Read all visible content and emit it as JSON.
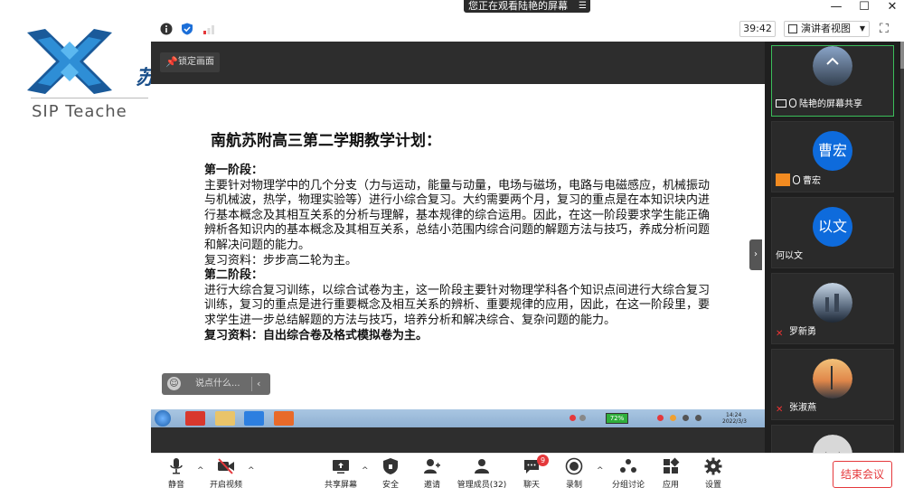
{
  "banner": {
    "text": "您正在观看陆艳的屏幕"
  },
  "topbar": {
    "timer": "39:42",
    "view_label": "演讲者视图"
  },
  "share": {
    "pin_label": "锁定画面",
    "chat_placeholder": "说点什么..."
  },
  "document": {
    "title": "南航苏附高三第二学期教学计划：",
    "paragraphs": [
      {
        "text": "第一阶段：",
        "bold": true
      },
      {
        "text": "主要针对物理学中的几个分支（力与运动，能量与动量，电场与磁场，电路与电磁感应，机械振动与机械波，热学，物理实验等）进行小综合复习。大约需要两个月，复习的重点是在本知识块内进行基本概念及其相互关系的分析与理解，基本规律的综合运用。因此，在这一阶段要求学生能正确辨析各知识内的基本概念及其相互关系，总结小范围内综合问题的解题方法与技巧，养成分析问题和解决问题的能力。",
        "bold": false
      },
      {
        "text": "复习资料：步步高二轮为主。",
        "bold": false
      },
      {
        "text": "第二阶段：",
        "bold": true
      },
      {
        "text": "进行大综合复习训练，以综合试卷为主，这一阶段主要针对物理学科各个知识点间进行大综合复习训练，复习的重点是进行重要概念及相互关系的辨析、重要规律的应用，因此，在这一阶段里，要求学生进一步总结解题的方法与技巧，培养分析和解决综合、复杂问题的能力。",
        "bold": false
      },
      {
        "text": "复习资料：自出综合卷及格式模拟卷为主。",
        "bold": true
      }
    ]
  },
  "taskbar": {
    "battery": "72%",
    "time": "14:24",
    "date": "2022/3/3"
  },
  "logo": {
    "text": "SIP Teache",
    "cn": "苏"
  },
  "participants": [
    {
      "name": "陆艳的屏幕共享",
      "kind": "screen",
      "active": true
    },
    {
      "name": "曹宏",
      "avatar_text": "曹宏",
      "kind": "avatar-person"
    },
    {
      "name": "何以文",
      "avatar_text": "以文",
      "kind": "avatar"
    },
    {
      "name": "罗新勇",
      "kind": "photo-muted"
    },
    {
      "name": "张淑燕",
      "kind": "photo-muted"
    },
    {
      "name": "",
      "kind": "photo"
    }
  ],
  "toolbar": {
    "mute": "静音",
    "video": "开启视频",
    "share": "共享屏幕",
    "security": "安全",
    "invite": "邀请",
    "members": "管理成员(32)",
    "chat": "聊天",
    "chat_badge": "9",
    "record": "录制",
    "breakout": "分组讨论",
    "apps": "应用",
    "settings": "设置",
    "end": "结束会议"
  }
}
